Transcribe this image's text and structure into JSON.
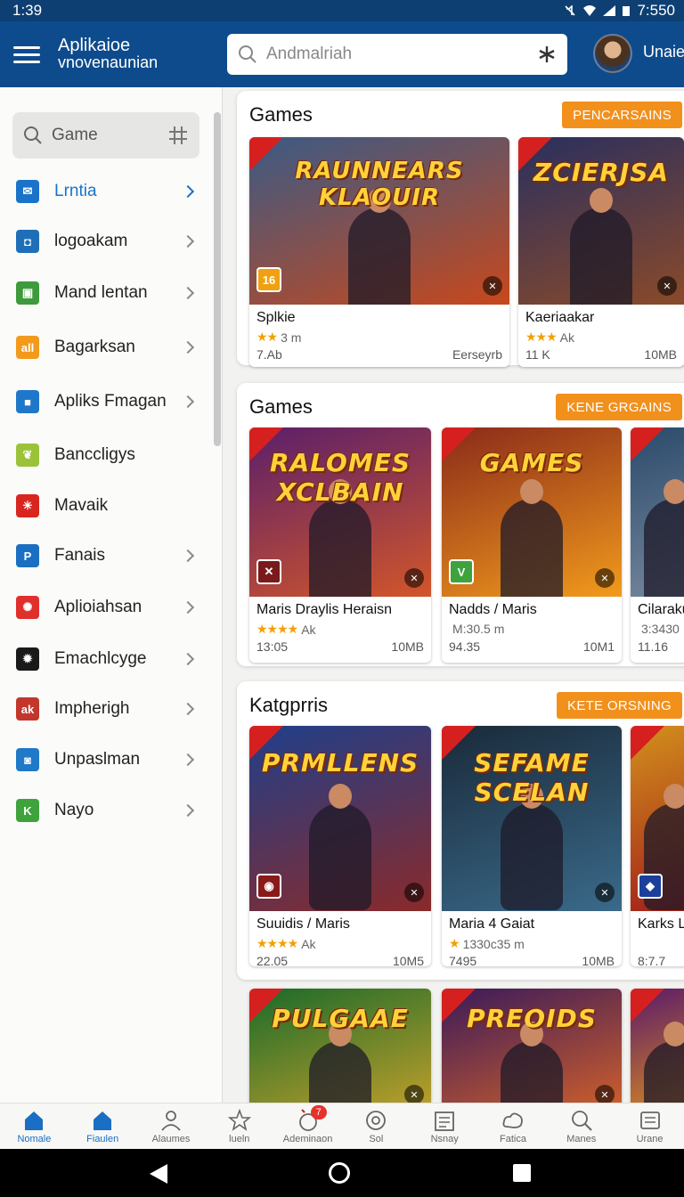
{
  "status_bar": {
    "time_left": "1:39",
    "time_right": "7:550"
  },
  "app_bar": {
    "title_line1": "Aplikaioe",
    "title_line2": "vnovenaunian",
    "search_placeholder": "Andmalriah",
    "username": "Unaie"
  },
  "sidebar": {
    "search_text": "Game",
    "items": [
      {
        "label": "Lrntia",
        "icon": "mail-icon",
        "color": "#1a73c9",
        "glyph": "✉",
        "active": true,
        "chevron": true
      },
      {
        "label": "logoakam",
        "icon": "frame-icon",
        "color": "#1e6fb8",
        "glyph": "◘",
        "chevron": true
      },
      {
        "label": "Mand lentan",
        "icon": "map-icon",
        "color": "#3e9a3c",
        "glyph": "▣",
        "chevron": true
      },
      {
        "label": "Bagarksan",
        "icon": "chart-icon",
        "color": "#f29a1c",
        "glyph": "all",
        "chevron": true
      },
      {
        "label": "Apliks Fmagan",
        "icon": "square-icon",
        "color": "#1f77c9",
        "glyph": "■",
        "chevron": true
      },
      {
        "label": "Banccligys",
        "icon": "leaf-icon",
        "color": "#9bc33a",
        "glyph": "❦",
        "chevron": false
      },
      {
        "label": "Mavaik",
        "icon": "burst-icon",
        "color": "#d8261f",
        "glyph": "✳",
        "chevron": false
      },
      {
        "label": "Fanais",
        "icon": "p-icon",
        "color": "#1b6fc2",
        "glyph": "P",
        "chevron": true
      },
      {
        "label": "Aplioiahsan",
        "icon": "sunburst-icon",
        "color": "#e0302c",
        "glyph": "✺",
        "chevron": true
      },
      {
        "label": "Emachlcyge",
        "icon": "gear-icon",
        "color": "#1a1a1a",
        "glyph": "✹",
        "chevron": true
      },
      {
        "label": "Impherigh",
        "icon": "ak-icon",
        "color": "#c2372c",
        "glyph": "ak",
        "chevron": true
      },
      {
        "label": "Unpaslman",
        "icon": "cup-icon",
        "color": "#1f78c8",
        "glyph": "◙",
        "chevron": true
      },
      {
        "label": "Nayo",
        "icon": "k-icon",
        "color": "#3ea33c",
        "glyph": "K",
        "chevron": true
      }
    ]
  },
  "sections": [
    {
      "title": "Games",
      "button": "PENCARSAINS",
      "cards": [
        {
          "art_title": "RAUNNEARS KLAOUIR",
          "name": "Splkie",
          "meta": "3 m",
          "stars": "★★",
          "foot_left": "7.Ab",
          "foot_right": "Eerseyrb",
          "badge": "16",
          "badge_color": "#f0a010",
          "bg1": "#3b5a85",
          "bg2": "#c7481c"
        },
        {
          "art_title": "ZCIERJSA",
          "name": "Kaeriaakar",
          "meta": "Ak",
          "stars": "★★★",
          "foot_left": "11 K",
          "foot_right": "10MB",
          "badge": "",
          "badge_color": "",
          "bg1": "#2a2f5e",
          "bg2": "#8a4a2a"
        }
      ]
    },
    {
      "title": "Games",
      "button": "KENE GRGAINS",
      "cards": [
        {
          "art_title": "RALOMES XCLBAIN",
          "name": "Maris Draylis Heraisn",
          "meta": "Ak",
          "stars": "★★★★",
          "foot_left": "13:05",
          "foot_right": "10MB",
          "badge": "✕",
          "badge_color": "#7a1a1a",
          "bg1": "#5a1f6a",
          "bg2": "#d2562a"
        },
        {
          "art_title": "GAMES",
          "name": "Nadds / Maris",
          "meta": "M:30.5 m",
          "stars": "",
          "foot_left": "94.35",
          "foot_right": "10M1",
          "badge": "V",
          "badge_color": "#3ea33c",
          "bg1": "#8a2a1a",
          "bg2": "#f29a1c"
        },
        {
          "art_title": "",
          "name": "Cilaraku",
          "meta": "3:3430",
          "stars": "",
          "foot_left": "11.16",
          "foot_right": "",
          "badge": "",
          "badge_color": "",
          "bg1": "#2a4a6a",
          "bg2": "#7a8aa0"
        }
      ]
    },
    {
      "title": "Katgprris",
      "button": "KETE ORSNING",
      "cards": [
        {
          "art_title": "PRMLLENS",
          "name": "Suuidis / Maris",
          "meta": "Ak",
          "stars": "★★★★",
          "foot_left": "22.05",
          "foot_right": "10M5",
          "badge": "◉",
          "badge_color": "#8a1a1a",
          "bg1": "#1f3f8a",
          "bg2": "#8a2a2a"
        },
        {
          "art_title": "SEFAME SCELAN",
          "name": "Maria 4 Gaiat",
          "meta": "1330c35 m",
          "stars": "★",
          "foot_left": "7495",
          "foot_right": "10MB",
          "badge": "",
          "badge_color": "",
          "bg1": "#1a2a3a",
          "bg2": "#3a6a8a"
        },
        {
          "art_title": "",
          "name": "Karks L",
          "meta": "",
          "stars": "",
          "foot_left": "8:7.7",
          "foot_right": "",
          "badge": "◆",
          "badge_color": "#1b3f9a",
          "bg1": "#d2901c",
          "bg2": "#a01a1a"
        }
      ]
    },
    {
      "title": "",
      "button": "",
      "cards": [
        {
          "art_title": "PULGAAE",
          "name": "",
          "meta": "",
          "stars": "",
          "foot_left": "",
          "foot_right": "",
          "badge": "",
          "badge_color": "",
          "bg1": "#1a6a2a",
          "bg2": "#c2a02a"
        },
        {
          "art_title": "PREOIDS",
          "name": "",
          "meta": "",
          "stars": "",
          "foot_left": "",
          "foot_right": "",
          "badge": "",
          "badge_color": "",
          "bg1": "#3a1a5a",
          "bg2": "#d2602a"
        },
        {
          "art_title": "",
          "name": "",
          "meta": "",
          "stars": "",
          "foot_left": "",
          "foot_right": "",
          "badge": "",
          "badge_color": "",
          "bg1": "#5a1a6a",
          "bg2": "#e0901c"
        }
      ]
    }
  ],
  "bottom_nav": [
    {
      "label": "Nomale",
      "icon": "home-icon",
      "active": true,
      "badge": ""
    },
    {
      "label": "Fiaulen",
      "icon": "house-icon",
      "active": true,
      "badge": ""
    },
    {
      "label": "Alaumes",
      "icon": "person-icon",
      "active": false,
      "badge": ""
    },
    {
      "label": "lueln",
      "icon": "star-icon",
      "active": false,
      "badge": ""
    },
    {
      "label": "Ademinaon",
      "icon": "bomb-icon",
      "active": false,
      "badge": "7"
    },
    {
      "label": "Sol",
      "icon": "target-icon",
      "active": false,
      "badge": ""
    },
    {
      "label": "Nsnay",
      "icon": "calendar-icon",
      "active": false,
      "badge": ""
    },
    {
      "label": "Fatica",
      "icon": "cloud-icon",
      "active": false,
      "badge": ""
    },
    {
      "label": "Manes",
      "icon": "search-icon",
      "active": false,
      "badge": ""
    },
    {
      "label": "Urane",
      "icon": "list-icon",
      "active": false,
      "badge": ""
    }
  ]
}
